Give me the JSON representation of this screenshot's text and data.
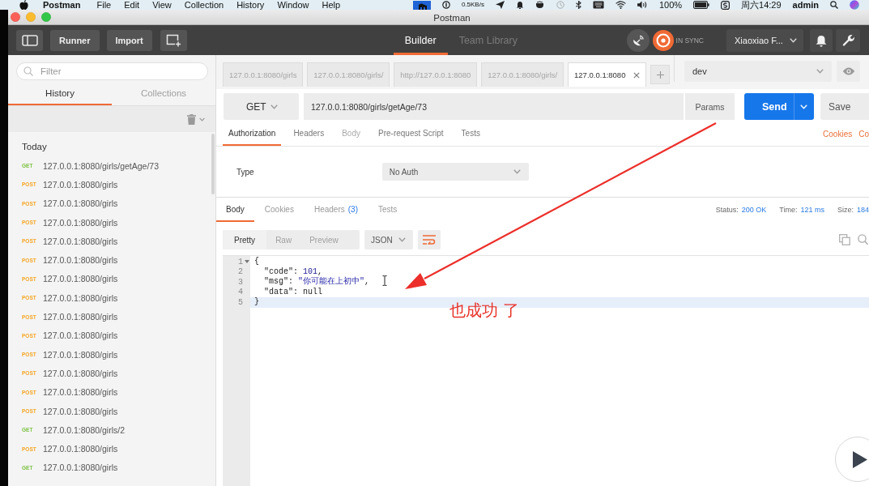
{
  "menu_bar": {
    "app": "Postman",
    "menus": [
      "File",
      "Edit",
      "View",
      "Collection",
      "History",
      "Window",
      "Help"
    ],
    "net_speed": "0.5KB/s",
    "battery": "100%",
    "clock": "周六14:29",
    "user": "admin"
  },
  "window": {
    "title": "Postman"
  },
  "toolbar": {
    "buttons": [
      "Runner",
      "Import"
    ],
    "views": [
      {
        "label": "Builder",
        "selected": true
      },
      {
        "label": "Team Library",
        "selected": false
      }
    ],
    "sync_status": "IN SYNC",
    "account": "Xiaoxiao F..."
  },
  "sidebar": {
    "filter": {
      "placeholder": "Filter"
    },
    "tabs": [
      {
        "label": "History",
        "selected": true
      },
      {
        "label": "Collections",
        "selected": false
      }
    ],
    "group": "Today",
    "items": [
      {
        "method": "GET",
        "color": "#7cc241",
        "url": "127.0.0.1:8080/girls/getAge/73"
      },
      {
        "method": "POST",
        "color": "#f5a623",
        "url": "127.0.0.1:8080/girls"
      },
      {
        "method": "POST",
        "color": "#f5a623",
        "url": "127.0.0.1:8080/girls"
      },
      {
        "method": "POST",
        "color": "#f5a623",
        "url": "127.0.0.1:8080/girls"
      },
      {
        "method": "POST",
        "color": "#f5a623",
        "url": "127.0.0.1:8080/girls"
      },
      {
        "method": "POST",
        "color": "#f5a623",
        "url": "127.0.0.1:8080/girls"
      },
      {
        "method": "POST",
        "color": "#f5a623",
        "url": "127.0.0.1:8080/girls"
      },
      {
        "method": "POST",
        "color": "#f5a623",
        "url": "127.0.0.1:8080/girls"
      },
      {
        "method": "POST",
        "color": "#f5a623",
        "url": "127.0.0.1:8080/girls"
      },
      {
        "method": "POST",
        "color": "#f5a623",
        "url": "127.0.0.1:8080/girls"
      },
      {
        "method": "POST",
        "color": "#f5a623",
        "url": "127.0.0.1:8080/girls"
      },
      {
        "method": "POST",
        "color": "#f5a623",
        "url": "127.0.0.1:8080/girls"
      },
      {
        "method": "POST",
        "color": "#f5a623",
        "url": "127.0.0.1:8080/girls"
      },
      {
        "method": "POST",
        "color": "#f5a623",
        "url": "127.0.0.1:8080/girls"
      },
      {
        "method": "GET",
        "color": "#7cc241",
        "url": "127.0.0.1:8080/girls/2"
      },
      {
        "method": "POST",
        "color": "#f5a623",
        "url": "127.0.0.1:8080/girls"
      },
      {
        "method": "GET",
        "color": "#7cc241",
        "url": "127.0.0.1:8080/girls"
      }
    ]
  },
  "request_tabs": {
    "tabs": [
      {
        "label": "127.0.0.1:8080/girls",
        "selected": false
      },
      {
        "label": "127.0.0.1:8080/girls/",
        "selected": false
      },
      {
        "label": "http://127.0.0.1:8080",
        "selected": false
      },
      {
        "label": "127.0.0.1:8080/girls/",
        "selected": false
      },
      {
        "label": "127.0.0.1:8080",
        "selected": true
      }
    ],
    "environment": "dev"
  },
  "request": {
    "method": "GET",
    "url": "127.0.0.1:8080/girls/getAge/73",
    "params": "Params",
    "send": "Send",
    "save": "Save"
  },
  "request_sections": {
    "tabs": [
      {
        "label": "Authorization",
        "selected": true,
        "disabled": false
      },
      {
        "label": "Headers",
        "selected": false,
        "disabled": false
      },
      {
        "label": "Body",
        "selected": false,
        "disabled": true
      },
      {
        "label": "Pre-request Script",
        "selected": false,
        "disabled": false
      },
      {
        "label": "Tests",
        "selected": false,
        "disabled": false
      }
    ],
    "links": [
      "Cookies",
      "Co"
    ]
  },
  "authorization": {
    "label": "Type",
    "value": "No Auth"
  },
  "response": {
    "tabs": [
      {
        "label": "Body",
        "selected": true
      },
      {
        "label": "Cookies",
        "selected": false
      },
      {
        "label": "Headers",
        "count": "(3)",
        "selected": false
      },
      {
        "label": "Tests",
        "selected": false
      }
    ],
    "meta": [
      {
        "label": "Status:",
        "value": "200 OK"
      },
      {
        "label": "Time:",
        "value": "121 ms"
      },
      {
        "label": "Size:",
        "value": "184"
      }
    ],
    "view_modes": [
      {
        "label": "Pretty",
        "selected": true
      },
      {
        "label": "Raw",
        "selected": false
      },
      {
        "label": "Preview",
        "selected": false
      }
    ],
    "format": "JSON",
    "lines": [
      {
        "number": "1",
        "foldable": true,
        "highlighted": false,
        "tokens": [
          {
            "kind": "punct",
            "text": "{"
          }
        ]
      },
      {
        "number": "2",
        "foldable": false,
        "highlighted": false,
        "tokens": [
          {
            "kind": "key",
            "text": "  \"code\""
          },
          {
            "kind": "punct",
            "text": ": "
          },
          {
            "kind": "number",
            "text": "101"
          },
          {
            "kind": "punct",
            "text": ","
          }
        ]
      },
      {
        "number": "3",
        "foldable": false,
        "highlighted": false,
        "tokens": [
          {
            "kind": "key",
            "text": "  \"msg\""
          },
          {
            "kind": "punct",
            "text": ": "
          },
          {
            "kind": "string",
            "text": "\"你可能在上初中\""
          },
          {
            "kind": "punct",
            "text": ","
          }
        ]
      },
      {
        "number": "4",
        "foldable": false,
        "highlighted": false,
        "tokens": [
          {
            "kind": "key",
            "text": "  \"data\""
          },
          {
            "kind": "punct",
            "text": ": "
          },
          {
            "kind": "keyword",
            "text": "null"
          }
        ]
      },
      {
        "number": "5",
        "foldable": false,
        "highlighted": true,
        "tokens": [
          {
            "kind": "punct",
            "text": "}"
          }
        ]
      }
    ]
  },
  "annotation": {
    "text": "也成功 了"
  }
}
